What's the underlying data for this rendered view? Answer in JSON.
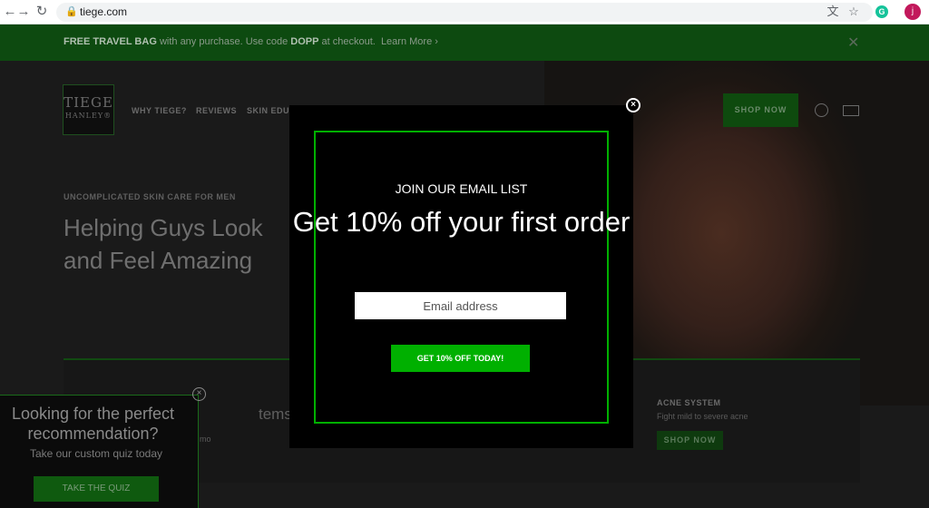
{
  "browser": {
    "back_icon": "←",
    "forward_icon": "→",
    "reload_icon": "↻",
    "lock_icon": "🔒",
    "url": "tiege.com",
    "translate_icon": "文",
    "star_icon": "☆",
    "grammarly_letter": "G",
    "profile_initial": "j"
  },
  "promo": {
    "bold_text": "FREE TRAVEL BAG",
    "text_1": " with any purchase. Use code ",
    "code": "DOPP",
    "text_2": " at checkout.",
    "link": "Learn More ›",
    "close": "✕"
  },
  "site": {
    "logo_line1": "TIEGE",
    "logo_line2": "HANLEY®",
    "nav": [
      "WHY TIEGE?",
      "REVIEWS",
      "SKIN EDU"
    ],
    "shop_now": "SHOP NOW",
    "hero_eyebrow": "UNCOMPLICATED SKIN CARE FOR MEN",
    "hero_title": "Helping Guys Look and Feel Amazing",
    "card_partial": "tems",
    "card_partial2": "mo",
    "acne_title": "ACNE SYSTEM",
    "acne_sub": "Fight mild to severe acne",
    "acne_button": "SHOP NOW"
  },
  "quiz": {
    "title": "Looking for the perfect recommendation?",
    "subtitle": "Take our custom quiz today",
    "button": "TAKE THE QUIZ",
    "close": "×"
  },
  "modal": {
    "close": "×",
    "eyebrow": "JOIN OUR EMAIL LIST",
    "headline": "Get 10% off your first order",
    "email_placeholder": "Email address",
    "email_value": "",
    "cta": "GET 10% OFF TODAY!"
  },
  "colors": {
    "brand_green": "#00b000",
    "promo_green": "#0d4a10"
  }
}
